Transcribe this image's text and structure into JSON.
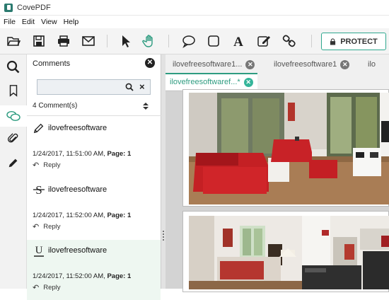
{
  "app": {
    "title": "CovePDF"
  },
  "menu": [
    "File",
    "Edit",
    "View",
    "Help"
  ],
  "toolbar": {
    "protect_label": "PROTECT"
  },
  "comments_panel": {
    "title": "Comments",
    "search_value": "",
    "count_label": "4 Comment(s)",
    "items": [
      {
        "type_icon": "pencil-icon",
        "user": "ilovefreesoftware",
        "date": "1/24/2017, 11:51:00 AM,",
        "page_label": "Page: 1",
        "reply": "Reply"
      },
      {
        "type_icon": "strikeout-icon",
        "user": "ilovefreesoftware",
        "date": "1/24/2017, 11:52:00 AM,",
        "page_label": "Page: 1",
        "reply": "Reply"
      },
      {
        "type_icon": "underline-icon",
        "user": "ilovefreesoftware",
        "date": "1/24/2017, 11:52:00 AM,",
        "page_label": "Page: 1",
        "reply": "Reply"
      }
    ]
  },
  "tabs": [
    {
      "label": "ilovefreesoftware1..."
    },
    {
      "label": "ilovefreesoftware1"
    },
    {
      "label": "ilo"
    },
    {
      "label": "ilovefreesoftwaref...*"
    }
  ],
  "colors": {
    "accent": "#2e9c80",
    "selected_comment_bg": "#eef7f1"
  }
}
